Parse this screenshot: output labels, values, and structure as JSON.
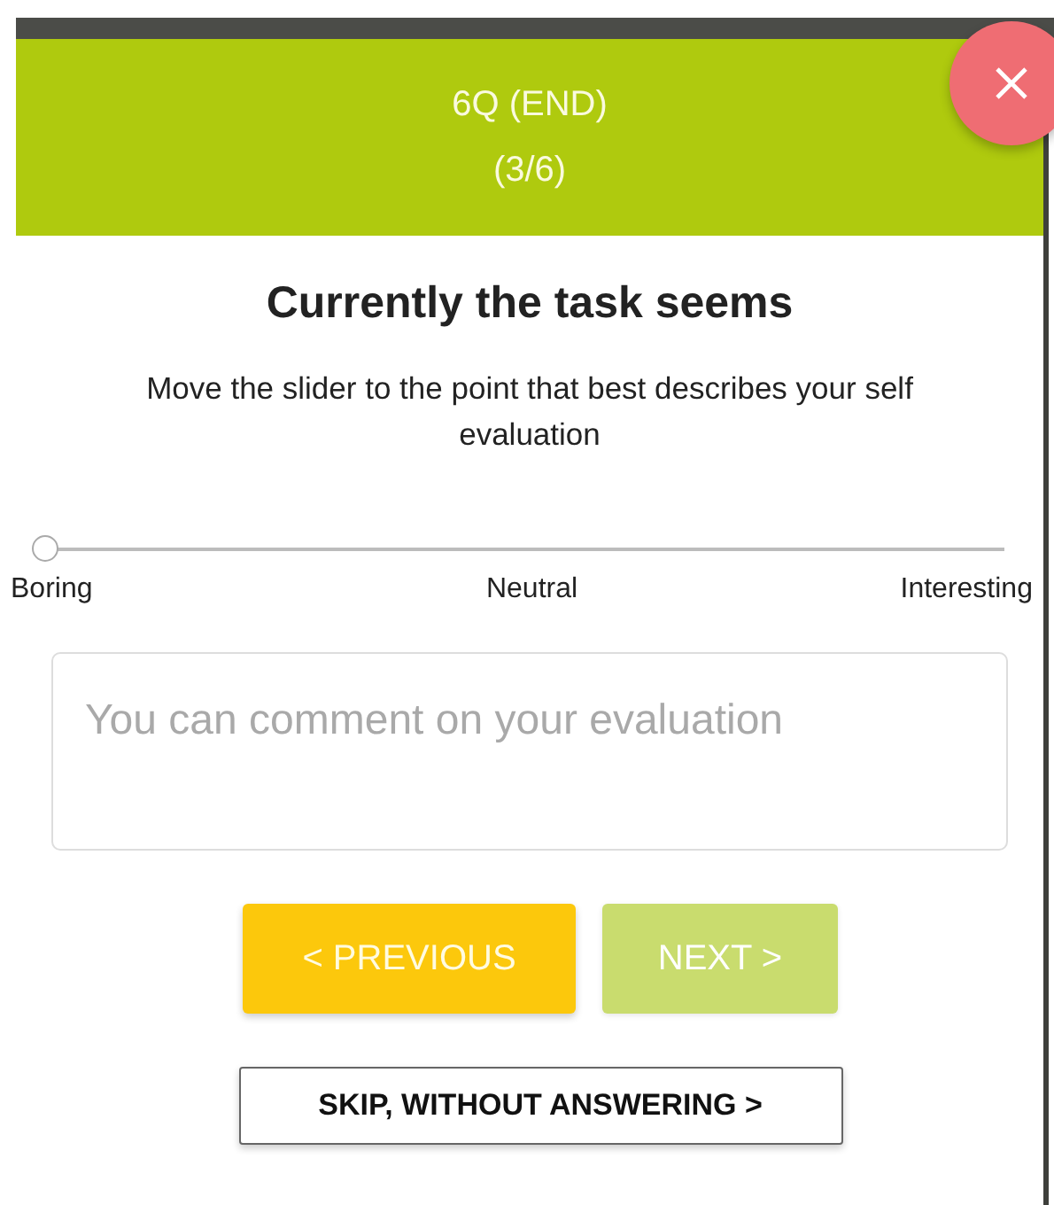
{
  "header": {
    "title": "6Q (END)",
    "progress": "(3/6)"
  },
  "question": {
    "title": "Currently the task seems",
    "instruction": "Move the slider to the point that best describes your self evaluation"
  },
  "slider": {
    "level": 0,
    "labels": [
      "Boring",
      "Neutral",
      "Interesting"
    ]
  },
  "comment": {
    "placeholder": "You can comment on your evaluation"
  },
  "buttons": [
    {
      "label": "< PREVIOUS",
      "kind": "previous",
      "disabled": false
    },
    {
      "label": "NEXT >",
      "kind": "next",
      "disabled": true
    },
    {
      "label": "SKIP, WITHOUT ANSWERING >",
      "kind": "skip",
      "disabled": false
    }
  ]
}
